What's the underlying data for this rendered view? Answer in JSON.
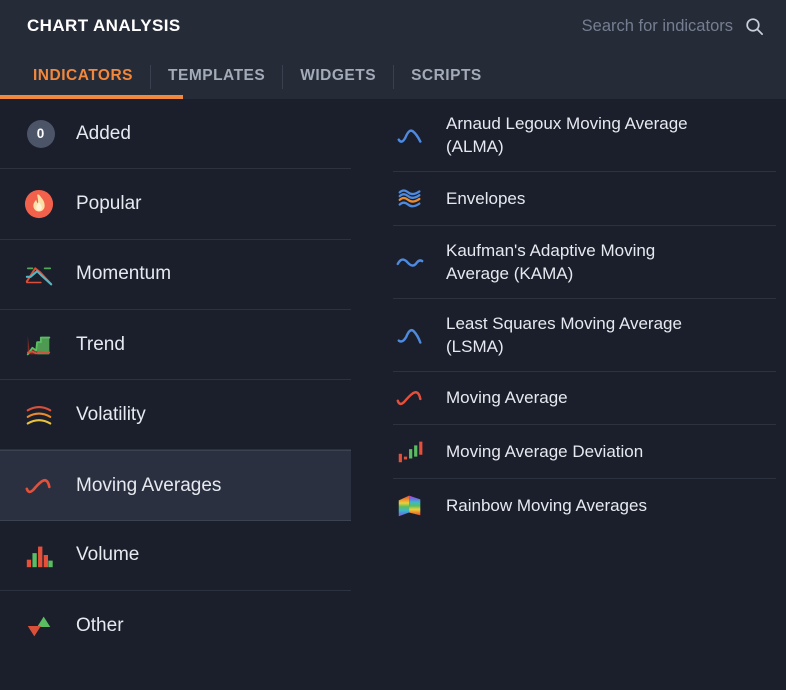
{
  "header": {
    "title": "CHART ANALYSIS",
    "search": {
      "placeholder": "Search for indicators",
      "value": "",
      "icon": "search-icon"
    },
    "tabs": [
      {
        "label": "INDICATORS",
        "active": true
      },
      {
        "label": "TEMPLATES",
        "active": false
      },
      {
        "label": "WIDGETS",
        "active": false
      },
      {
        "label": "SCRIPTS",
        "active": false
      }
    ],
    "accent_color": "#f2883c",
    "background_color": "#262b38"
  },
  "sidebar": {
    "categories": [
      {
        "label": "Added",
        "icon": "badge-count-icon",
        "badge": "0",
        "selected": false
      },
      {
        "label": "Popular",
        "icon": "flame-icon",
        "selected": false
      },
      {
        "label": "Momentum",
        "icon": "momentum-lines-icon",
        "selected": false
      },
      {
        "label": "Trend",
        "icon": "trend-area-icon",
        "selected": false
      },
      {
        "label": "Volatility",
        "icon": "volatility-arcs-icon",
        "selected": false
      },
      {
        "label": "Moving Averages",
        "icon": "moving-average-curve-icon",
        "selected": true
      },
      {
        "label": "Volume",
        "icon": "volume-bars-icon",
        "selected": false
      },
      {
        "label": "Other",
        "icon": "up-down-triangles-icon",
        "selected": false
      }
    ]
  },
  "list": {
    "items": [
      {
        "label": "Arnaud Legoux Moving Average (ALMA)",
        "icon": "alma-curve-icon",
        "tall": true
      },
      {
        "label": "Envelopes",
        "icon": "envelopes-waves-icon",
        "tall": false
      },
      {
        "label": "Kaufman's Adaptive Moving Average (KAMA)",
        "icon": "kama-curve-icon",
        "tall": true
      },
      {
        "label": "Least Squares Moving Average (LSMA)",
        "icon": "lsma-curve-icon",
        "tall": true
      },
      {
        "label": "Moving Average",
        "icon": "moving-average-curve-icon",
        "tall": false
      },
      {
        "label": "Moving Average Deviation",
        "icon": "deviation-bars-icon",
        "tall": false
      },
      {
        "label": "Rainbow Moving Averages",
        "icon": "rainbow-bands-icon",
        "tall": false
      }
    ]
  },
  "colors": {
    "background": "#1b1f2b",
    "panel": "#262b38",
    "accent": "#f2883c",
    "selected_row": "#2a3040",
    "divider": "#2c3240",
    "text": "#e6e9ef",
    "muted_text": "#a3abb8",
    "blue": "#4d8ae0",
    "red": "#e5503a",
    "green": "#58b25b"
  }
}
